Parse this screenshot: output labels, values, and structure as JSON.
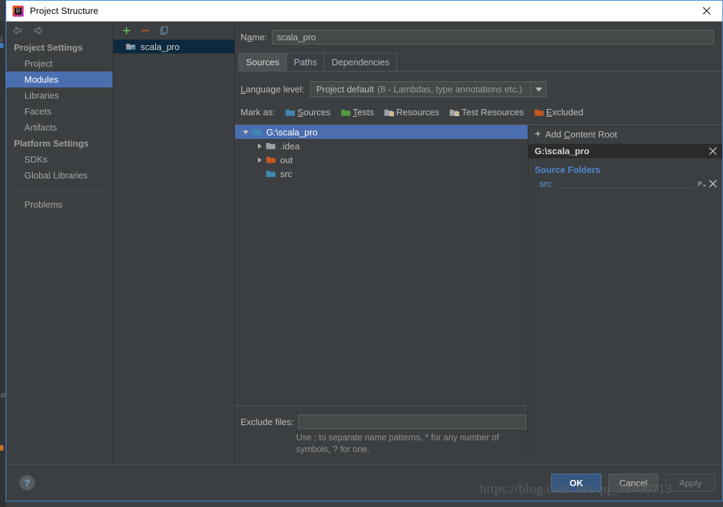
{
  "window": {
    "title": "Project Structure",
    "app_icon": "intellij-idea-icon",
    "close_label": "✕"
  },
  "nav_toolbar": {
    "back_icon": "arrow-left-icon",
    "forward_icon": "arrow-right-icon"
  },
  "sidebar": {
    "sections": [
      {
        "title": "Project Settings",
        "items": [
          {
            "label": "Project",
            "selected": false
          },
          {
            "label": "Modules",
            "selected": true
          },
          {
            "label": "Libraries",
            "selected": false
          },
          {
            "label": "Facets",
            "selected": false
          },
          {
            "label": "Artifacts",
            "selected": false
          }
        ]
      },
      {
        "title": "Platform Settings",
        "items": [
          {
            "label": "SDKs",
            "selected": false
          },
          {
            "label": "Global Libraries",
            "selected": false
          }
        ]
      }
    ],
    "extra_items": [
      {
        "label": "Problems",
        "selected": false
      }
    ]
  },
  "modules_panel": {
    "toolbar": {
      "add_icon": "plus-icon",
      "remove_icon": "minus-icon",
      "copy_icon": "copy-icon"
    },
    "items": [
      {
        "label": "scala_pro",
        "icon": "module-folder-icon",
        "selected": true
      }
    ]
  },
  "main": {
    "name_label": "Name:",
    "name_value": "scala_pro",
    "tabs": [
      {
        "label": "Sources",
        "active": true
      },
      {
        "label": "Paths",
        "active": false
      },
      {
        "label": "Dependencies",
        "active": false
      }
    ],
    "language_level": {
      "label": "Language level:",
      "value_strong": "Project default",
      "value_dim": "(8 - Lambdas, type annotations etc.)",
      "caret_icon": "chevron-down-icon"
    },
    "mark_as": {
      "label": "Mark as:",
      "options": [
        {
          "label": "Sources",
          "color": "#3e87b0",
          "icon": "folder-sources-icon"
        },
        {
          "label": "Tests",
          "color": "#539a3e",
          "icon": "folder-tests-icon"
        },
        {
          "label": "Resources",
          "color": "#9aa0a6",
          "icon": "folder-resources-icon"
        },
        {
          "label": "Test Resources",
          "color": "#9aa0a6",
          "icon": "folder-test-resources-icon"
        },
        {
          "label": "Excluded",
          "color": "#c2571f",
          "icon": "folder-excluded-icon"
        }
      ]
    },
    "tree": [
      {
        "label": "G:\\scala_pro",
        "level": 1,
        "expanded": true,
        "twisty": "expanded",
        "color": "#3e87b0",
        "selected": true,
        "icon": "folder-content-root-icon"
      },
      {
        "label": ".idea",
        "level": 2,
        "expanded": false,
        "twisty": "collapsed",
        "color": "#9aa0a6",
        "selected": false,
        "icon": "folder-icon"
      },
      {
        "label": "out",
        "level": 2,
        "expanded": false,
        "twisty": "collapsed",
        "color": "#c2571f",
        "selected": false,
        "icon": "folder-excluded-icon"
      },
      {
        "label": "src",
        "level": 2,
        "expanded": false,
        "twisty": "none",
        "color": "#3e87b0",
        "selected": false,
        "icon": "folder-sources-icon"
      }
    ],
    "exclude": {
      "label": "Exclude files:",
      "value": "",
      "hint": "Use ; to separate name patterns, * for any number of symbols, ? for one."
    }
  },
  "right_panel": {
    "add_content_root": "Add Content Root",
    "add_icon": "plus-icon",
    "content_root": {
      "path": "G:\\scala_pro",
      "remove_icon": "close-icon"
    },
    "source_folders_title": "Source Folders",
    "source_folders": [
      {
        "name": "src",
        "package_prefix_icon": "package-prefix-icon",
        "remove_icon": "close-icon"
      }
    ]
  },
  "footer": {
    "help_label": "?",
    "buttons": [
      {
        "label": "OK",
        "style": "primary",
        "enabled": true
      },
      {
        "label": "Cancel",
        "style": "normal",
        "enabled": true
      },
      {
        "label": "Apply",
        "style": "disabled",
        "enabled": false
      }
    ]
  },
  "watermark": "https://blog.csdn.net/qq_39490713"
}
